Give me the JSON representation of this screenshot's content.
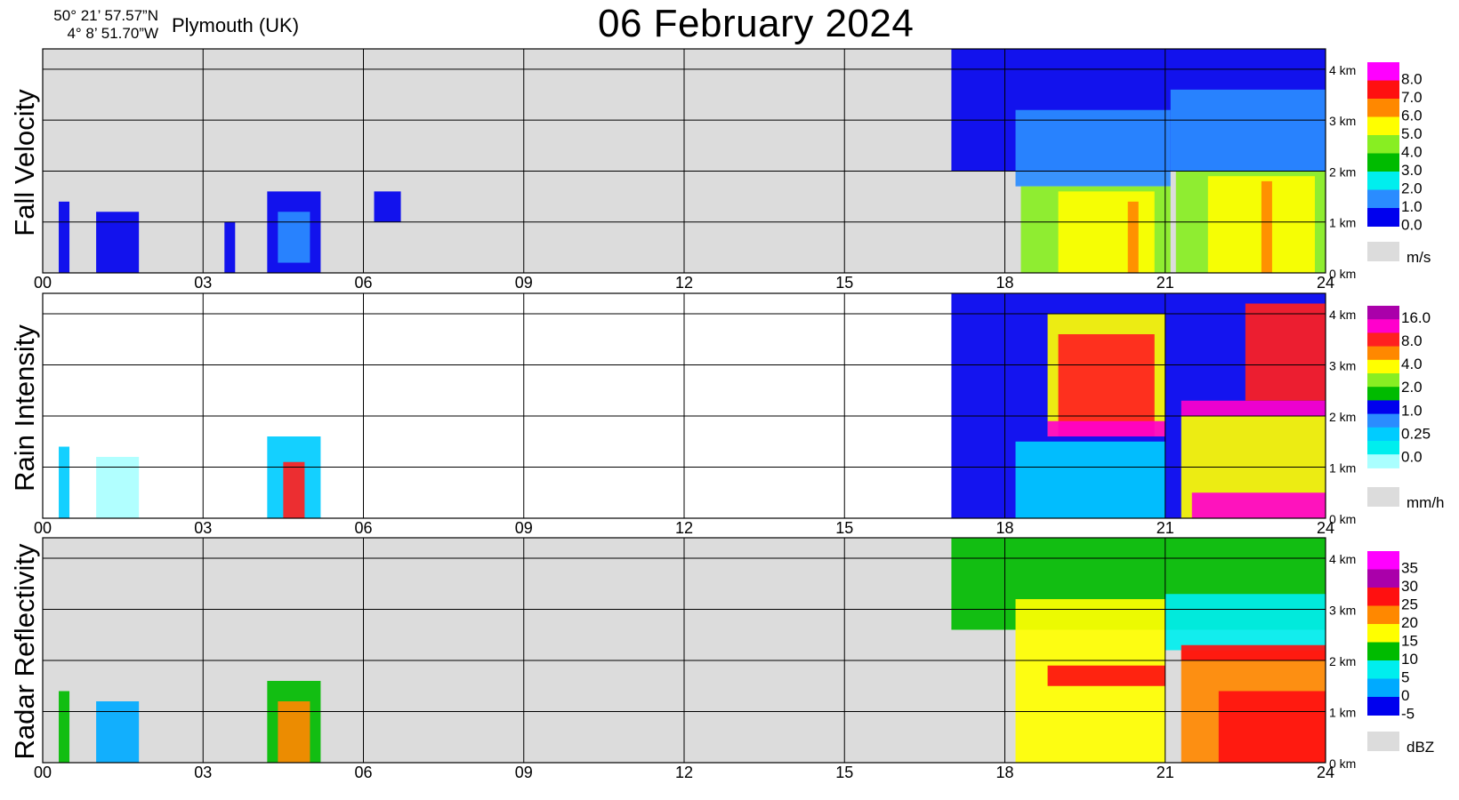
{
  "header": {
    "lat": "50° 21’ 57.57”N",
    "lon": "4°  8’ 51.70”W",
    "location": "Plymouth (UK)",
    "title": "06 February  2024"
  },
  "chart_data": [
    {
      "type": "heatmap",
      "title": "Fall Velocity",
      "ylabel": "Fall Velocity",
      "x_ticks": [
        "00",
        "03",
        "06",
        "09",
        "12",
        "15",
        "18",
        "21",
        "24"
      ],
      "xlim": [
        0,
        24
      ],
      "y_ticks": [
        "0 km",
        "1 km",
        "2 km",
        "3 km",
        "4 km"
      ],
      "ylim": [
        0,
        4.4
      ],
      "background": "#dcdcdc",
      "colorbar": {
        "unit": "m/s",
        "labels": [
          "8.0",
          "7.0",
          "6.0",
          "5.0",
          "4.0",
          "3.0",
          "2.0",
          "1.0",
          "0.0"
        ],
        "colors": [
          "#ff00ff",
          "#ff1010",
          "#ff8800",
          "#ffff00",
          "#88ee22",
          "#00bb00",
          "#00eeee",
          "#2a8cff",
          "#0000ee"
        ]
      },
      "cells": [
        {
          "t0": 0.3,
          "t1": 0.5,
          "h0": 0,
          "h1": 1.4,
          "c": "#0000ee"
        },
        {
          "t0": 1.0,
          "t1": 1.8,
          "h0": 0,
          "h1": 1.2,
          "c": "#0000ee"
        },
        {
          "t0": 3.4,
          "t1": 3.6,
          "h0": 0,
          "h1": 1.0,
          "c": "#0000ee"
        },
        {
          "t0": 4.2,
          "t1": 5.2,
          "h0": 0,
          "h1": 1.6,
          "c": "#0000ee"
        },
        {
          "t0": 4.4,
          "t1": 5.0,
          "h0": 0.2,
          "h1": 1.2,
          "c": "#2a8cff"
        },
        {
          "t0": 6.2,
          "t1": 6.7,
          "h0": 1.0,
          "h1": 1.6,
          "c": "#0000ee"
        },
        {
          "t0": 17.0,
          "t1": 24,
          "h0": 2.0,
          "h1": 4.4,
          "c": "#0000ee"
        },
        {
          "t0": 18.2,
          "t1": 21.1,
          "h0": 1.7,
          "h1": 3.2,
          "c": "#2a8cff"
        },
        {
          "t0": 21.1,
          "t1": 24,
          "h0": 2.0,
          "h1": 3.6,
          "c": "#2a8cff"
        },
        {
          "t0": 18.3,
          "t1": 21.1,
          "h0": 0,
          "h1": 1.7,
          "c": "#88ee22"
        },
        {
          "t0": 21.2,
          "t1": 24,
          "h0": 0,
          "h1": 2.0,
          "c": "#88ee22"
        },
        {
          "t0": 19.0,
          "t1": 20.8,
          "h0": 0,
          "h1": 1.6,
          "c": "#ffff00"
        },
        {
          "t0": 21.8,
          "t1": 23.8,
          "h0": 0,
          "h1": 1.9,
          "c": "#ffff00"
        },
        {
          "t0": 20.3,
          "t1": 20.5,
          "h0": 0,
          "h1": 1.4,
          "c": "#ff8800"
        },
        {
          "t0": 22.8,
          "t1": 23.0,
          "h0": 0,
          "h1": 1.8,
          "c": "#ff8800"
        }
      ]
    },
    {
      "type": "heatmap",
      "title": "Rain Intensity",
      "ylabel": "Rain Intensity",
      "x_ticks": [
        "00",
        "03",
        "06",
        "09",
        "12",
        "15",
        "18",
        "21",
        "24"
      ],
      "xlim": [
        0,
        24
      ],
      "y_ticks": [
        "0 km",
        "1 km",
        "2 km",
        "3 km",
        "4 km"
      ],
      "ylim": [
        0,
        4.4
      ],
      "background": "#ffffff",
      "colorbar": {
        "unit": "mm/h",
        "labels": [
          "16.0",
          "8.0",
          "4.0",
          "2.0",
          "1.0",
          "0.25",
          "0.0"
        ],
        "colors": [
          "#aa00aa",
          "#ff00cc",
          "#ff2020",
          "#ff8800",
          "#ffff00",
          "#88ee22",
          "#00bb00",
          "#0000ee",
          "#2a8cff",
          "#00ccff",
          "#00eeee",
          "#aaffff"
        ]
      },
      "cells": [
        {
          "t0": 0.3,
          "t1": 0.5,
          "h0": 0,
          "h1": 1.4,
          "c": "#00ccff"
        },
        {
          "t0": 1.0,
          "t1": 1.8,
          "h0": 0,
          "h1": 1.2,
          "c": "#aaffff"
        },
        {
          "t0": 4.2,
          "t1": 5.2,
          "h0": 0,
          "h1": 1.6,
          "c": "#00ccff"
        },
        {
          "t0": 4.5,
          "t1": 4.9,
          "h0": 0,
          "h1": 1.1,
          "c": "#ff2020"
        },
        {
          "t0": 17.0,
          "t1": 24,
          "h0": 0,
          "h1": 4.4,
          "c": "#0000ee"
        },
        {
          "t0": 18.2,
          "t1": 21.0,
          "h0": 0,
          "h1": 1.5,
          "c": "#00ccff"
        },
        {
          "t0": 18.8,
          "t1": 21.0,
          "h0": 1.6,
          "h1": 4.0,
          "c": "#ffff00"
        },
        {
          "t0": 19.0,
          "t1": 20.8,
          "h0": 1.6,
          "h1": 3.6,
          "c": "#ff2020"
        },
        {
          "t0": 21.3,
          "t1": 24,
          "h0": 0,
          "h1": 2.0,
          "c": "#ffff00"
        },
        {
          "t0": 21.5,
          "t1": 24,
          "h0": 0,
          "h1": 0.5,
          "c": "#ff00cc"
        },
        {
          "t0": 21.3,
          "t1": 24,
          "h0": 2.0,
          "h1": 2.3,
          "c": "#ff00cc"
        },
        {
          "t0": 18.8,
          "t1": 21.0,
          "h0": 1.6,
          "h1": 1.9,
          "c": "#ff00cc"
        },
        {
          "t0": 22.5,
          "t1": 24,
          "h0": 2.3,
          "h1": 4.2,
          "c": "#ff2020"
        }
      ]
    },
    {
      "type": "heatmap",
      "title": "Radar Reflectivity",
      "ylabel": "Radar Reflectivity",
      "x_ticks": [
        "00",
        "03",
        "06",
        "09",
        "12",
        "15",
        "18",
        "21",
        "24"
      ],
      "xlim": [
        0,
        24
      ],
      "y_ticks": [
        "0 km",
        "1 km",
        "2 km",
        "3 km",
        "4 km"
      ],
      "ylim": [
        0,
        4.4
      ],
      "background": "#dcdcdc",
      "colorbar": {
        "unit": "dBZ",
        "labels": [
          "35",
          "30",
          "25",
          "20",
          "15",
          "10",
          "5",
          "0",
          "-5"
        ],
        "colors": [
          "#ff00ff",
          "#aa00aa",
          "#ff1010",
          "#ff8800",
          "#ffff00",
          "#00bb00",
          "#00eeee",
          "#00aaff",
          "#0000ee"
        ]
      },
      "cells": [
        {
          "t0": 0.3,
          "t1": 0.5,
          "h0": 0,
          "h1": 1.4,
          "c": "#00bb00"
        },
        {
          "t0": 1.0,
          "t1": 1.8,
          "h0": 0,
          "h1": 1.2,
          "c": "#00aaff"
        },
        {
          "t0": 4.2,
          "t1": 5.2,
          "h0": 0,
          "h1": 1.6,
          "c": "#00bb00"
        },
        {
          "t0": 4.4,
          "t1": 5.0,
          "h0": 0,
          "h1": 1.2,
          "c": "#ff8800"
        },
        {
          "t0": 17.0,
          "t1": 24,
          "h0": 2.6,
          "h1": 4.4,
          "c": "#00bb00"
        },
        {
          "t0": 18.2,
          "t1": 21.0,
          "h0": 0,
          "h1": 3.2,
          "c": "#ffff00"
        },
        {
          "t0": 18.8,
          "t1": 21.0,
          "h0": 1.5,
          "h1": 1.9,
          "c": "#ff1010"
        },
        {
          "t0": 21.0,
          "t1": 24,
          "h0": 2.2,
          "h1": 3.3,
          "c": "#00eeee"
        },
        {
          "t0": 21.3,
          "t1": 24,
          "h0": 0,
          "h1": 2.2,
          "c": "#ff8800"
        },
        {
          "t0": 22.0,
          "t1": 24,
          "h0": 0,
          "h1": 1.4,
          "c": "#ff1010"
        },
        {
          "t0": 21.3,
          "t1": 24,
          "h0": 2.0,
          "h1": 2.3,
          "c": "#ff1010"
        }
      ]
    }
  ]
}
